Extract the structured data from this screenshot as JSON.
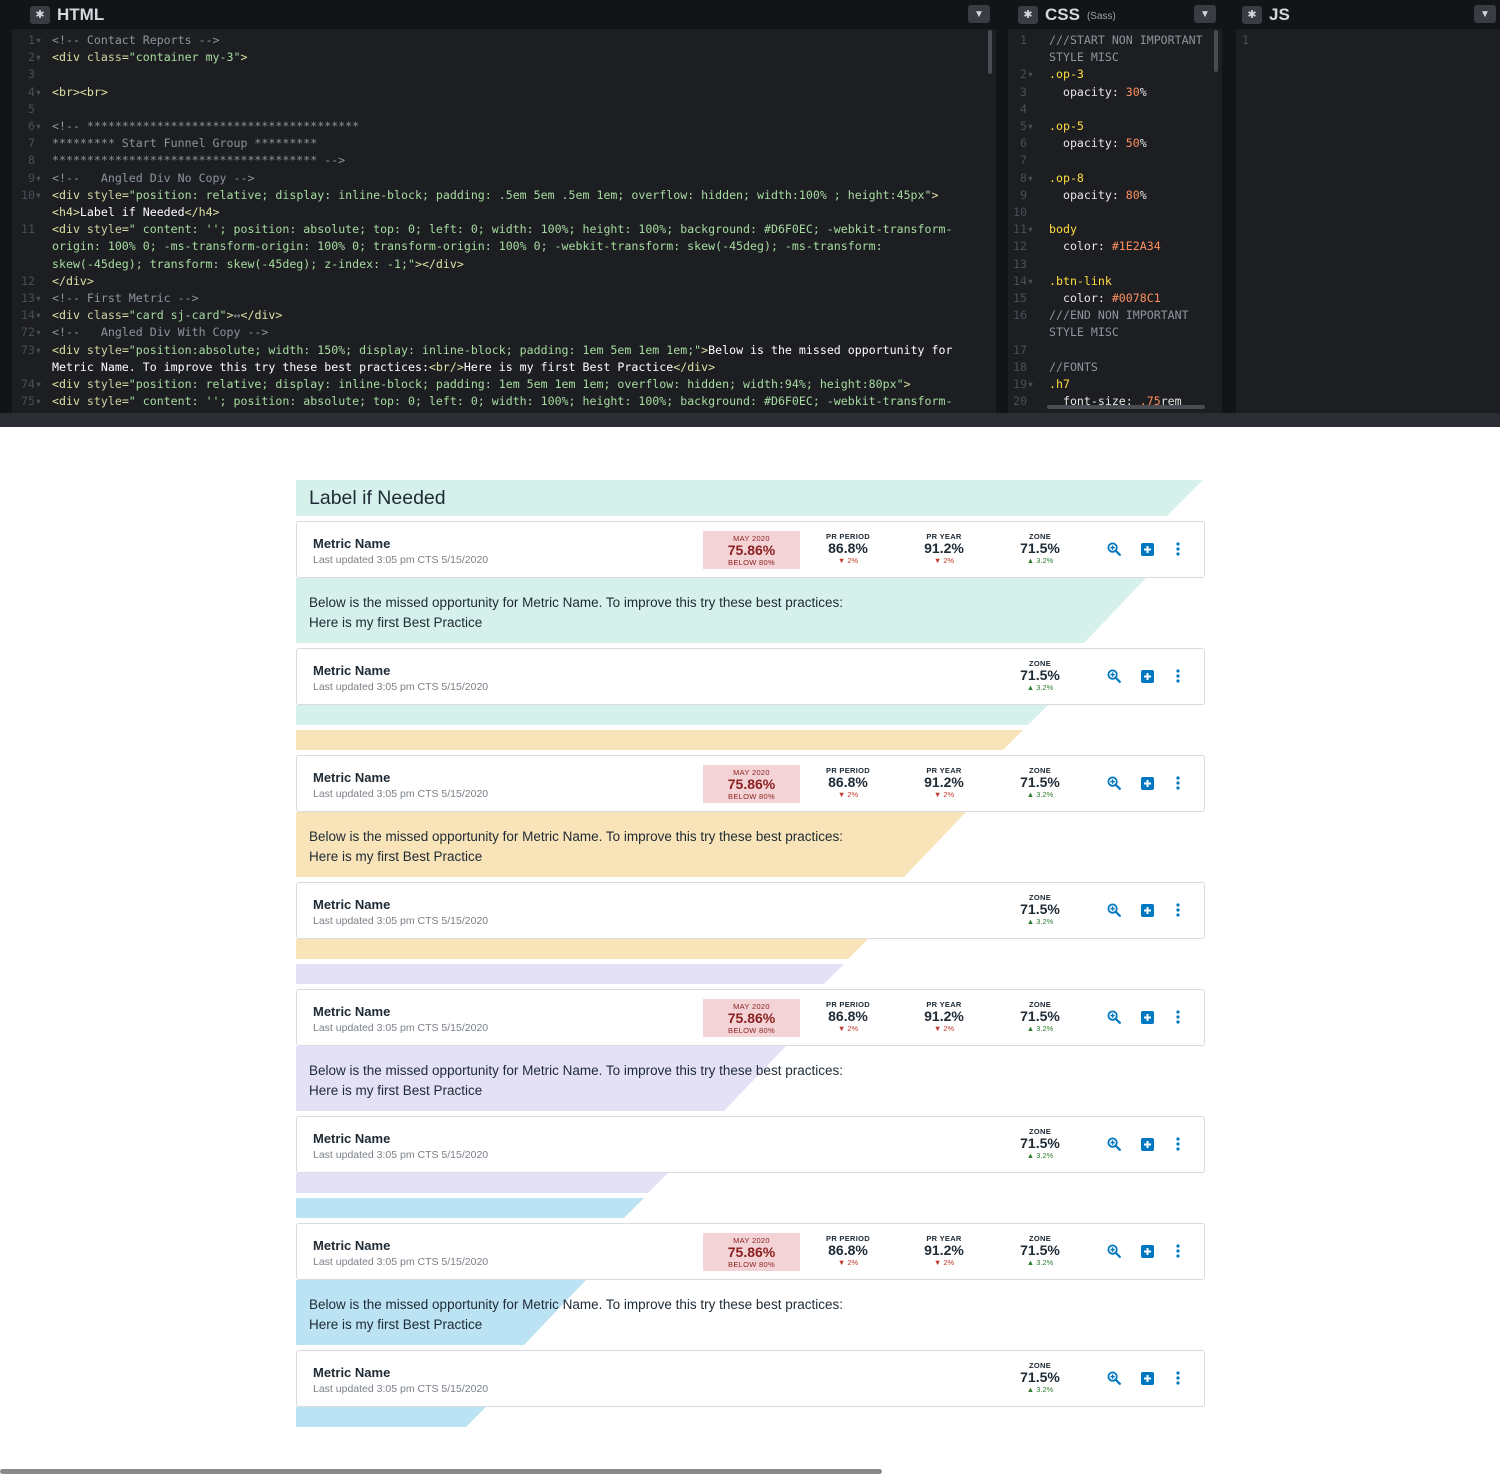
{
  "editor": {
    "html_pane": {
      "title": "HTML",
      "lines": [
        {
          "n": "1",
          "f": true,
          "parts": [
            [
              "c-cm",
              "<!-- Contact Reports -->"
            ]
          ]
        },
        {
          "n": "2",
          "f": true,
          "parts": [
            [
              "c-tag",
              "<div "
            ],
            [
              "c-at",
              "class"
            ],
            [
              "c-tag",
              "="
            ],
            [
              "c-st",
              "\"container my-3\""
            ],
            [
              "c-tag",
              ">"
            ]
          ]
        },
        {
          "n": "3",
          "f": false,
          "parts": []
        },
        {
          "n": "4",
          "f": true,
          "parts": [
            [
              "c-tag",
              "<br><br>"
            ]
          ]
        },
        {
          "n": "5",
          "f": false,
          "parts": []
        },
        {
          "n": "6",
          "f": true,
          "parts": [
            [
              "c-cm",
              "<!-- ***************************************"
            ]
          ]
        },
        {
          "n": "7",
          "f": false,
          "parts": [
            [
              "c-cm",
              "********* Start Funnel Group *********"
            ]
          ]
        },
        {
          "n": "8",
          "f": false,
          "parts": [
            [
              "c-cm",
              "************************************** -->"
            ]
          ]
        },
        {
          "n": "9",
          "f": true,
          "parts": [
            [
              "c-cm",
              "<!--   Angled Div No Copy -->"
            ]
          ]
        },
        {
          "n": "10",
          "f": true,
          "parts": [
            [
              "c-tag",
              "<div "
            ],
            [
              "c-at",
              "style"
            ],
            [
              "c-tag",
              "="
            ],
            [
              "c-st",
              "\"position: relative; display: inline-block; padding: .5em 5em .5em 1em; overflow: hidden; width:100% ; height:45px\""
            ],
            [
              "c-tag",
              ">"
            ]
          ]
        },
        {
          "n": "",
          "f": false,
          "parts": [
            [
              "c-tag",
              "<h4>"
            ],
            [
              "c-wh",
              "Label if Needed"
            ],
            [
              "c-tag",
              "</h4>"
            ]
          ]
        },
        {
          "n": "11",
          "f": false,
          "parts": [
            [
              "c-tag",
              "<div "
            ],
            [
              "c-at",
              "style"
            ],
            [
              "c-tag",
              "="
            ],
            [
              "c-st",
              "\" content: ''; position: absolute; top: 0; left: 0; width: 100%; height: 100%; background: #D6F0EC; -webkit-transform-"
            ]
          ]
        },
        {
          "n": "",
          "f": false,
          "parts": [
            [
              "c-st",
              "origin: 100% 0; -ms-transform-origin: 100% 0; transform-origin: 100% 0; -webkit-transform: skew(-45deg); -ms-transform:"
            ]
          ]
        },
        {
          "n": "",
          "f": false,
          "parts": [
            [
              "c-st",
              "skew(-45deg); transform: skew(-45deg); z-index: -1;\""
            ],
            [
              "c-tag",
              "></div>"
            ]
          ]
        },
        {
          "n": "12",
          "f": false,
          "parts": [
            [
              "c-tag",
              "</div>"
            ]
          ]
        },
        {
          "n": "13",
          "f": true,
          "parts": [
            [
              "c-cm",
              "<!-- First Metric -->"
            ]
          ]
        },
        {
          "n": "14",
          "f": true,
          "parts": [
            [
              "c-tag",
              "<div "
            ],
            [
              "c-at",
              "class"
            ],
            [
              "c-tag",
              "="
            ],
            [
              "c-st",
              "\"card sj-card\""
            ],
            [
              "c-tag",
              ">"
            ],
            [
              "c-cm",
              "↔"
            ],
            [
              "c-tag",
              "</div>"
            ]
          ]
        },
        {
          "n": "72",
          "f": true,
          "parts": [
            [
              "c-cm",
              "<!--   Angled Div With Copy -->"
            ]
          ]
        },
        {
          "n": "73",
          "f": true,
          "parts": [
            [
              "c-tag",
              "<div "
            ],
            [
              "c-at",
              "style"
            ],
            [
              "c-tag",
              "="
            ],
            [
              "c-st",
              "\"position:absolute; width: 150%; display: inline-block; padding: 1em 5em 1em 1em;\""
            ],
            [
              "c-tag",
              ">"
            ],
            [
              "c-wh",
              "Below is the missed opportunity for"
            ]
          ]
        },
        {
          "n": "",
          "f": false,
          "parts": [
            [
              "c-wh",
              "Metric Name. To improve this try these best practices:"
            ],
            [
              "c-tag",
              "<br/>"
            ],
            [
              "c-wh",
              "Here is my first Best Practice"
            ],
            [
              "c-tag",
              "</div>"
            ]
          ]
        },
        {
          "n": "74",
          "f": true,
          "parts": [
            [
              "c-tag",
              "<div "
            ],
            [
              "c-at",
              "style"
            ],
            [
              "c-tag",
              "="
            ],
            [
              "c-st",
              "\"position: relative; display: inline-block; padding: 1em 5em 1em 1em; overflow: hidden; width:94%; height:80px\""
            ],
            [
              "c-tag",
              ">"
            ]
          ]
        },
        {
          "n": "75",
          "f": true,
          "parts": [
            [
              "c-tag",
              "<div "
            ],
            [
              "c-at",
              "style"
            ],
            [
              "c-tag",
              "="
            ],
            [
              "c-st",
              "\" content: ''; position: absolute; top: 0; left: 0; width: 100%; height: 100%; background: #D6F0EC; -webkit-transform-"
            ]
          ]
        }
      ]
    },
    "css_pane": {
      "title": "CSS",
      "subtitle": "(Sass)",
      "lines": [
        {
          "n": "1",
          "f": false,
          "parts": [
            [
              "c-cm",
              "///START NON IMPORTANT"
            ]
          ]
        },
        {
          "n": "",
          "f": false,
          "parts": [
            [
              "c-cm",
              "STYLE MISC"
            ]
          ]
        },
        {
          "n": "2",
          "f": true,
          "parts": [
            [
              "c-kw",
              ".op-3"
            ]
          ]
        },
        {
          "n": "3",
          "f": false,
          "parts": [
            [
              "c-pr",
              "  opacity: "
            ],
            [
              "c-num",
              "30"
            ],
            [
              "c-pr",
              "%"
            ]
          ]
        },
        {
          "n": "4",
          "f": false,
          "parts": []
        },
        {
          "n": "5",
          "f": true,
          "parts": [
            [
              "c-kw",
              ".op-5"
            ]
          ]
        },
        {
          "n": "6",
          "f": false,
          "parts": [
            [
              "c-pr",
              "  opacity: "
            ],
            [
              "c-num",
              "50"
            ],
            [
              "c-pr",
              "%"
            ]
          ]
        },
        {
          "n": "7",
          "f": false,
          "parts": []
        },
        {
          "n": "8",
          "f": true,
          "parts": [
            [
              "c-kw",
              ".op-8"
            ]
          ]
        },
        {
          "n": "9",
          "f": false,
          "parts": [
            [
              "c-pr",
              "  opacity: "
            ],
            [
              "c-num",
              "80"
            ],
            [
              "c-pr",
              "%"
            ]
          ]
        },
        {
          "n": "10",
          "f": false,
          "parts": []
        },
        {
          "n": "11",
          "f": true,
          "parts": [
            [
              "c-kw",
              "body"
            ]
          ]
        },
        {
          "n": "12",
          "f": false,
          "parts": [
            [
              "c-pr",
              "  color: "
            ],
            [
              "c-num",
              "#1E2A34"
            ]
          ]
        },
        {
          "n": "13",
          "f": false,
          "parts": []
        },
        {
          "n": "14",
          "f": true,
          "parts": [
            [
              "c-kw",
              ".btn-link"
            ]
          ]
        },
        {
          "n": "15",
          "f": false,
          "parts": [
            [
              "c-pr",
              "  color: "
            ],
            [
              "c-num",
              "#0078C1"
            ]
          ]
        },
        {
          "n": "16",
          "f": false,
          "parts": [
            [
              "c-cm",
              "///END NON IMPORTANT"
            ]
          ]
        },
        {
          "n": "",
          "f": false,
          "parts": [
            [
              "c-cm",
              "STYLE MISC"
            ]
          ]
        },
        {
          "n": "17",
          "f": false,
          "parts": []
        },
        {
          "n": "18",
          "f": false,
          "parts": [
            [
              "c-cm",
              "//FONTS"
            ]
          ]
        },
        {
          "n": "19",
          "f": true,
          "parts": [
            [
              "c-kw",
              ".h7"
            ]
          ]
        },
        {
          "n": "20",
          "f": false,
          "parts": [
            [
              "c-pr",
              "  font-size: "
            ],
            [
              "c-num",
              ".75"
            ],
            [
              "c-pr",
              "rem"
            ]
          ]
        }
      ]
    },
    "js_pane": {
      "title": "JS",
      "lines": [
        {
          "n": "1",
          "f": false,
          "parts": []
        }
      ]
    }
  },
  "label": "Label if Needed",
  "colors": {
    "teal": "#D6F0EC",
    "yellow": "#F8E4B8",
    "purple": "#E4E1F7",
    "blue": "#BCE3F4",
    "text": "#1E2A34",
    "link": "#0078C1",
    "red_bg": "#F3D3D5"
  },
  "icons": [
    "zoom-in-icon",
    "plus-square-icon",
    "kebab-menu-icon"
  ],
  "card_texts": {
    "name": "Metric Name",
    "updated": "Last updated 3:05 pm CTS 5/15/2020",
    "period_label": "MAY 2020",
    "period_value": "75.86%",
    "period_status": "BELOW 80%",
    "pr_period_label": "PR PERIOD",
    "pr_period_value": "86.8%",
    "pr_period_delta": "▼ 2%",
    "pr_year_label": "PR YEAR",
    "pr_year_value": "91.2%",
    "pr_year_delta": "▼ 2%",
    "zone_label": "ZONE",
    "zone_value": "71.5%",
    "zone_delta": "▲ 3.2%"
  },
  "opportunity": {
    "line1": "Below is the missed opportunity for Metric Name. To improve this try these best practices:",
    "line2": "Here is my first Best Practice"
  }
}
